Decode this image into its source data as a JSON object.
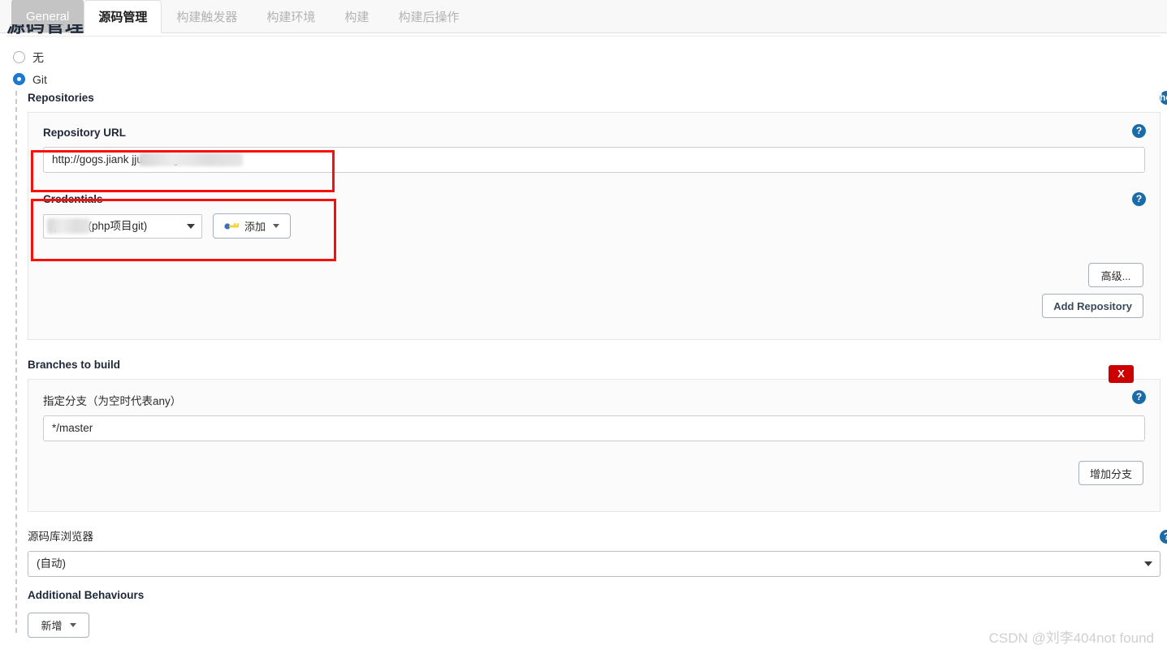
{
  "tabs": [
    {
      "label": "General",
      "state": "hovered"
    },
    {
      "label": "源码管理",
      "state": "active"
    },
    {
      "label": "构建触发器",
      "state": "normal"
    },
    {
      "label": "构建环境",
      "state": "normal"
    },
    {
      "label": "构建",
      "state": "normal"
    },
    {
      "label": "构建后操作",
      "state": "normal"
    }
  ],
  "section": {
    "heading": "源码管理"
  },
  "scm": {
    "options": [
      {
        "label": "无",
        "selected": false
      },
      {
        "label": "Git",
        "selected": true
      }
    ]
  },
  "repositories": {
    "group_label": "Repositories",
    "url_label": "Repository URL",
    "url_value": "http://gogs.jiank                jju/tuniu.git",
    "url_value_prefix": "http://gogs.jiank",
    "url_value_suffix": "jju/tuniu.git",
    "credentials_label": "Credentials",
    "credentials_value": "                q/****** (php项目git)",
    "credentials_value_tail": "q/****** (php项目git)",
    "add_credentials_label": "添加",
    "advanced_label": "高级...",
    "add_repository_label": "Add Repository",
    "help_icon": "help-icon"
  },
  "branches": {
    "group_label": "Branches to build",
    "spec_label": "指定分支（为空时代表any）",
    "spec_value": "*/master",
    "add_branch_label": "增加分支",
    "delete_label": "X"
  },
  "browser": {
    "label": "源码库浏览器",
    "value": "(自动)"
  },
  "additional": {
    "label": "Additional Behaviours",
    "add_label": "新增"
  },
  "watermark": "CSDN @刘李404not found",
  "colors": {
    "accent": "#1f78d1",
    "help_blue": "#1a6ca8",
    "annotation_red": "#fb0f09",
    "delete_red": "#cc0000"
  }
}
